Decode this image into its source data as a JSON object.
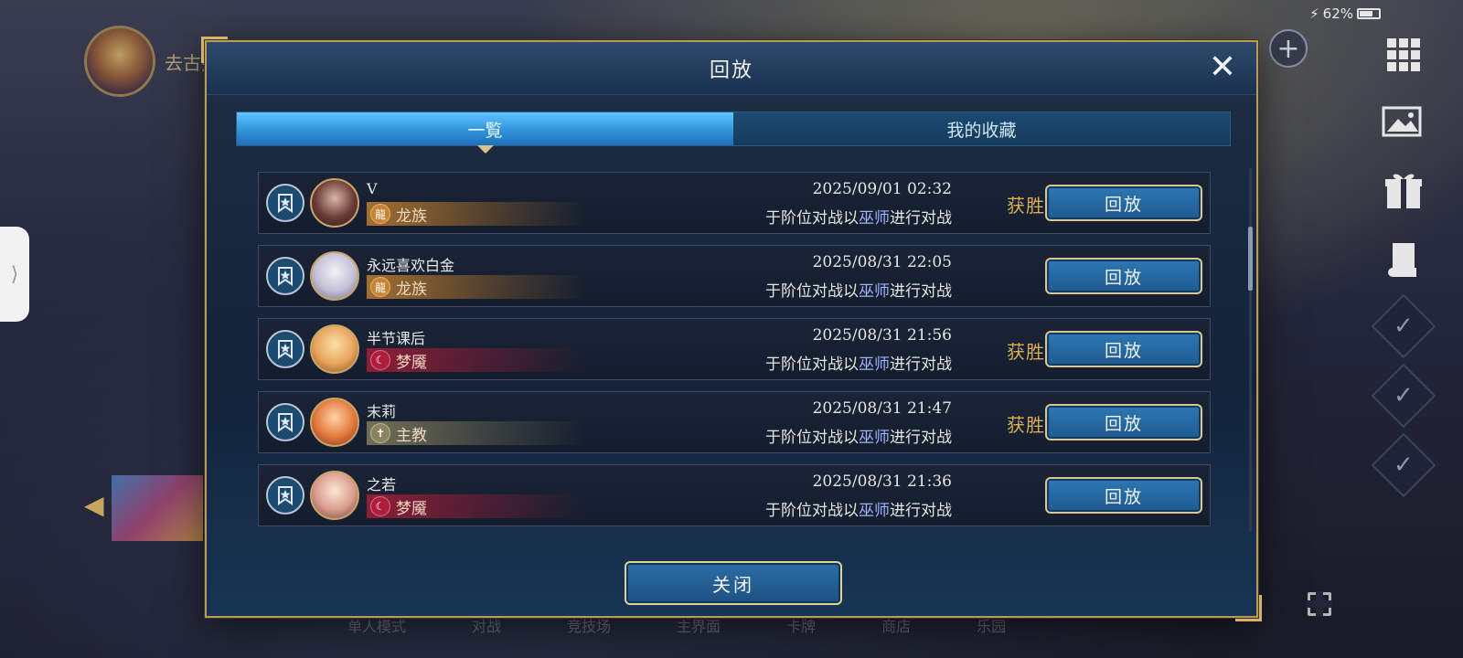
{
  "status": {
    "battery_text": "62%"
  },
  "background": {
    "player_name": "去古幾",
    "bottom_nav": [
      "单人模式",
      "对战",
      "竞技场",
      "主界面",
      "卡牌",
      "商店",
      "乐园"
    ]
  },
  "dialog": {
    "title": "回放",
    "tabs": [
      {
        "label": "一覧",
        "active": true
      },
      {
        "label": "我的收藏",
        "active": false
      }
    ],
    "rows": [
      {
        "name": "V",
        "class": "龙族",
        "class_color": "#c7832f",
        "class_icon": "dragon-icon",
        "datetime": "2025/09/01  02:32",
        "desc_prefix": "于阶位对战以",
        "desc_hl": "巫师",
        "desc_suffix": "进行对战",
        "result": "获胜",
        "replay_label": "回放"
      },
      {
        "name": "永远喜欢白金",
        "class": "龙族",
        "class_color": "#c7832f",
        "class_icon": "dragon-icon",
        "datetime": "2025/08/31  22:05",
        "desc_prefix": "于阶位对战以",
        "desc_hl": "巫师",
        "desc_suffix": "进行对战",
        "result": "",
        "replay_label": "回放"
      },
      {
        "name": "半节课后",
        "class": "梦魇",
        "class_color": "#b01d3a",
        "class_icon": "nightmare-icon",
        "datetime": "2025/08/31  21:56",
        "desc_prefix": "于阶位对战以",
        "desc_hl": "巫师",
        "desc_suffix": "进行对战",
        "result": "获胜",
        "replay_label": "回放"
      },
      {
        "name": "末莉",
        "class": "主教",
        "class_color": "#8a8360",
        "class_icon": "bishop-icon",
        "datetime": "2025/08/31  21:47",
        "desc_prefix": "于阶位对战以",
        "desc_hl": "巫师",
        "desc_suffix": "进行对战",
        "result": "获胜",
        "replay_label": "回放"
      },
      {
        "name": "之若",
        "class": "梦魇",
        "class_color": "#b01d3a",
        "class_icon": "nightmare-icon",
        "datetime": "2025/08/31  21:36",
        "desc_prefix": "于阶位对战以",
        "desc_hl": "巫师",
        "desc_suffix": "进行对战",
        "result": "",
        "replay_label": "回放"
      }
    ],
    "close_label": "关闭"
  }
}
